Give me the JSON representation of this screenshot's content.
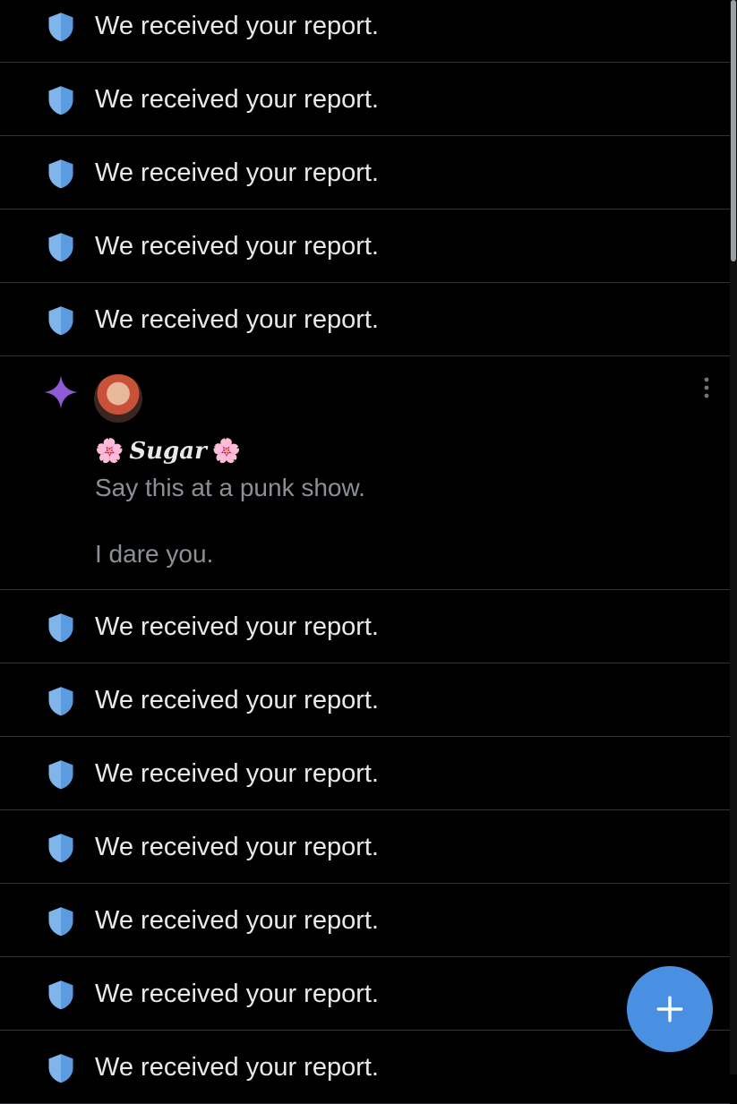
{
  "notifications": [
    {
      "type": "report",
      "text": "We received your report.",
      "icon": "shield-icon"
    },
    {
      "type": "report",
      "text": "We received your report.",
      "icon": "shield-icon"
    },
    {
      "type": "report",
      "text": "We received your report.",
      "icon": "shield-icon"
    },
    {
      "type": "report",
      "text": "We received your report.",
      "icon": "shield-icon"
    },
    {
      "type": "report",
      "text": "We received your report.",
      "icon": "shield-icon"
    },
    {
      "type": "post",
      "icon": "sparkle-icon",
      "display_name_prefix": "🌸",
      "display_name": "Sugar",
      "display_name_suffix": "🌸",
      "line1": "Say this at a punk show.",
      "line2": "I dare you."
    },
    {
      "type": "report",
      "text": "We received your report.",
      "icon": "shield-icon"
    },
    {
      "type": "report",
      "text": "We received your report.",
      "icon": "shield-icon"
    },
    {
      "type": "report",
      "text": "We received your report.",
      "icon": "shield-icon"
    },
    {
      "type": "report",
      "text": "We received your report.",
      "icon": "shield-icon"
    },
    {
      "type": "report",
      "text": "We received your report.",
      "icon": "shield-icon"
    },
    {
      "type": "report",
      "text": "We received your report.",
      "icon": "shield-icon"
    },
    {
      "type": "report",
      "text": "We received your report.",
      "icon": "shield-icon"
    }
  ],
  "colors": {
    "background": "#000000",
    "shield": "#7fb5ea",
    "sparkle": "#8e5ad6",
    "fab": "#4a90e2",
    "muted_text": "#8b9096",
    "divider": "#2f3336"
  },
  "fab": {
    "icon": "plus-icon"
  }
}
